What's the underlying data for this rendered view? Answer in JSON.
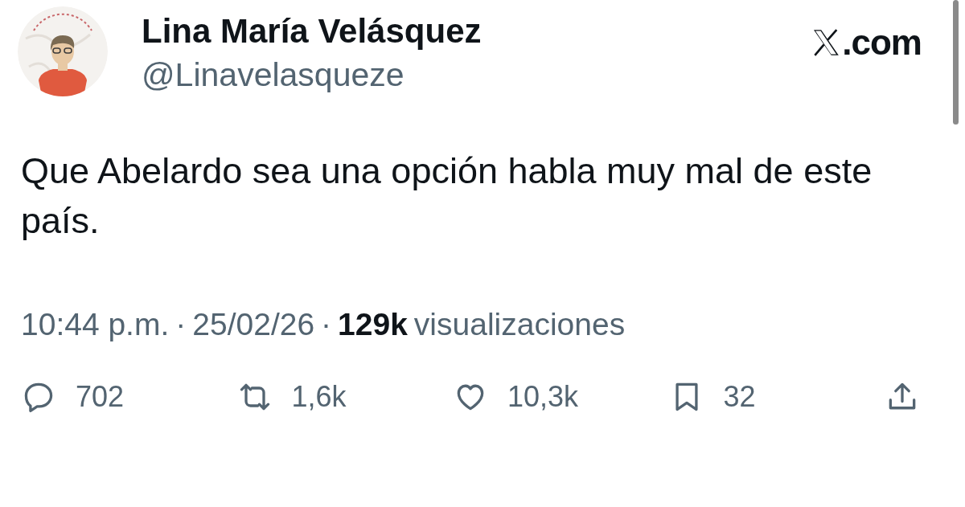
{
  "author": {
    "name": "Lina María Velásquez",
    "handle": "@Linavelasqueze"
  },
  "source": {
    "domain": ".com"
  },
  "tweet": {
    "text": "Que Abelardo sea una opción habla muy mal de este país."
  },
  "meta": {
    "time": "10:44 p.m.",
    "separator": "·",
    "date": "25/02/26",
    "views": "129k",
    "views_label": "visualizaciones"
  },
  "actions": [
    {
      "kind": "reply",
      "count": "702"
    },
    {
      "kind": "repost",
      "count": "1,6k"
    },
    {
      "kind": "like",
      "count": "10,3k"
    },
    {
      "kind": "bookmark",
      "count": "32"
    },
    {
      "kind": "share"
    }
  ]
}
